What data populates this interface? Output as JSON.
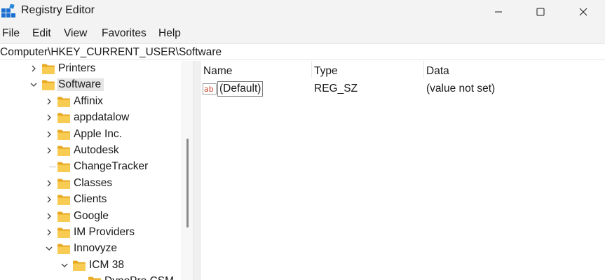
{
  "window": {
    "title": "Registry Editor",
    "controls": [
      "minimize-icon",
      "maximize-icon",
      "close-icon"
    ]
  },
  "menu": [
    "File",
    "Edit",
    "View",
    "Favorites",
    "Help"
  ],
  "address": "Computer\\HKEY_CURRENT_USER\\Software",
  "tree": {
    "nodes": [
      {
        "label": "Printers",
        "expander": "collapsed"
      },
      {
        "label": "Software",
        "expander": "expanded",
        "selected": true
      },
      {
        "label": "Affinix",
        "expander": "collapsed"
      },
      {
        "label": "appdatalow",
        "expander": "collapsed"
      },
      {
        "label": "Apple Inc.",
        "expander": "collapsed"
      },
      {
        "label": "Autodesk",
        "expander": "collapsed"
      },
      {
        "label": "ChangeTracker",
        "expander": "none"
      },
      {
        "label": "Classes",
        "expander": "collapsed"
      },
      {
        "label": "Clients",
        "expander": "collapsed"
      },
      {
        "label": "Google",
        "expander": "collapsed"
      },
      {
        "label": "IM Providers",
        "expander": "collapsed"
      },
      {
        "label": "Innovyze",
        "expander": "expanded"
      },
      {
        "label": "ICM 38",
        "expander": "expanded"
      },
      {
        "label": "DynoPro CSM",
        "expander": "none"
      }
    ]
  },
  "list": {
    "columns": [
      "Name",
      "Type",
      "Data"
    ],
    "rows": [
      {
        "name": "(Default)",
        "type": "REG_SZ",
        "data": "(value not set)",
        "icon": "string-value-icon"
      }
    ]
  },
  "colors": {
    "folder": "#f8cb52",
    "folder_dark": "#e8a922",
    "titlebar": "#f3f3f3",
    "selection": "#e5e5e5",
    "ab_icon_red": "#c8432b"
  }
}
